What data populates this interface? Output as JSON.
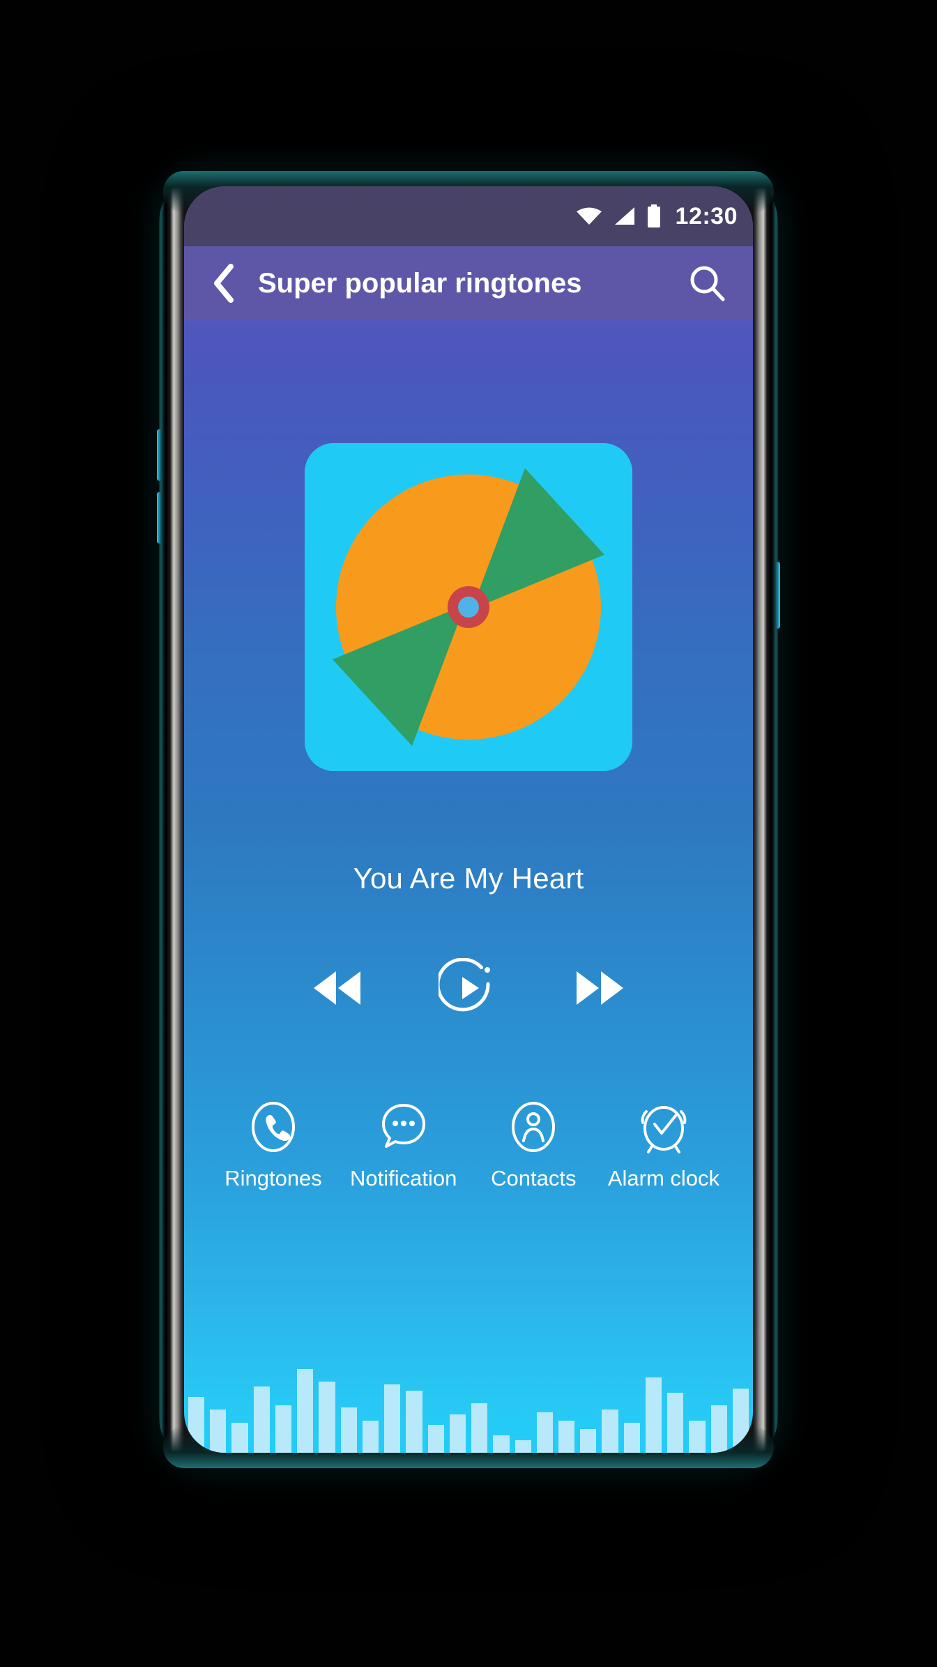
{
  "statusbar": {
    "time": "12:30",
    "icons": [
      "wifi-icon",
      "signal-icon",
      "battery-icon"
    ]
  },
  "appbar": {
    "back_icon": "chevron-left-icon",
    "title": "Super popular ringtones",
    "search_icon": "search-icon",
    "background_color": "#5e57a8"
  },
  "player": {
    "album_art": {
      "name": "album-art",
      "background_color": "#1fcbf5",
      "disc_color": "#f89a1c",
      "blade_color": "#319e63",
      "hub_ring_color": "#c8444a",
      "hub_center_color": "#4fb3e8"
    },
    "song_title": "You Are My Heart",
    "controls": {
      "previous_label": "rewind-icon",
      "play_label": "play-icon",
      "next_label": "fast-forward-icon"
    }
  },
  "actions": [
    {
      "icon": "phone-icon",
      "label": "Ringtones"
    },
    {
      "icon": "chat-bubble-icon",
      "label": "Notification"
    },
    {
      "icon": "person-icon",
      "label": "Contacts"
    },
    {
      "icon": "alarm-clock-icon",
      "label": "Alarm clock"
    }
  ],
  "equalizer": {
    "bar_color": "#b8e9fa",
    "heights": [
      52,
      40,
      28,
      62,
      44,
      78,
      66,
      42,
      30,
      64,
      58,
      26,
      36,
      46,
      16,
      12,
      38,
      30,
      22,
      40,
      28,
      70,
      56,
      30,
      44,
      60
    ]
  },
  "theme": {
    "gradient_top": "#5b55b8",
    "gradient_mid": "#2e78c0",
    "gradient_bottom": "#22cdf8",
    "statusbar_color": "#474266",
    "text_color": "#ffffff"
  }
}
